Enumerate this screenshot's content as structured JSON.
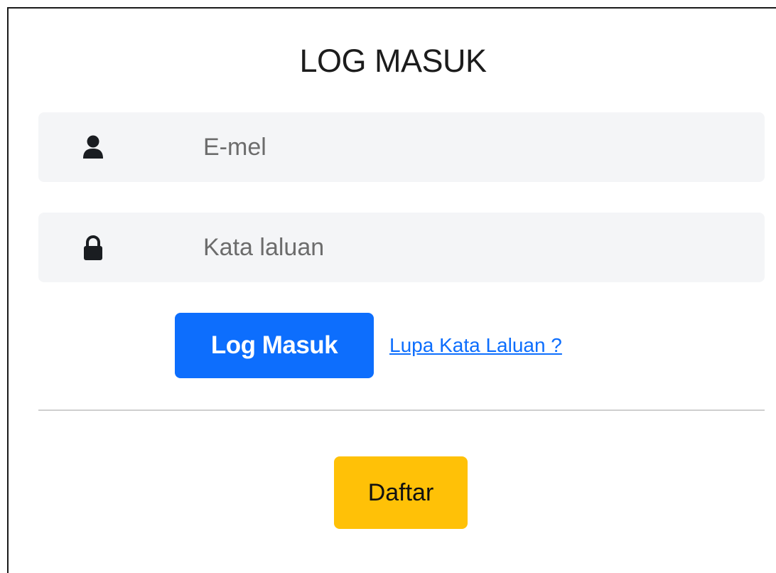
{
  "form": {
    "title": "LOG MASUK",
    "email": {
      "icon": "user-icon",
      "placeholder": "E-mel",
      "value": ""
    },
    "password": {
      "icon": "lock-icon",
      "placeholder": "Kata laluan",
      "value": ""
    },
    "login_label": "Log Masuk",
    "forgot_label": "Lupa Kata Laluan ?",
    "register_label": "Daftar"
  },
  "colors": {
    "primary": "#0d6efd",
    "warning": "#ffc107",
    "field_bg": "#f4f5f7",
    "divider": "#cfcfcf"
  }
}
